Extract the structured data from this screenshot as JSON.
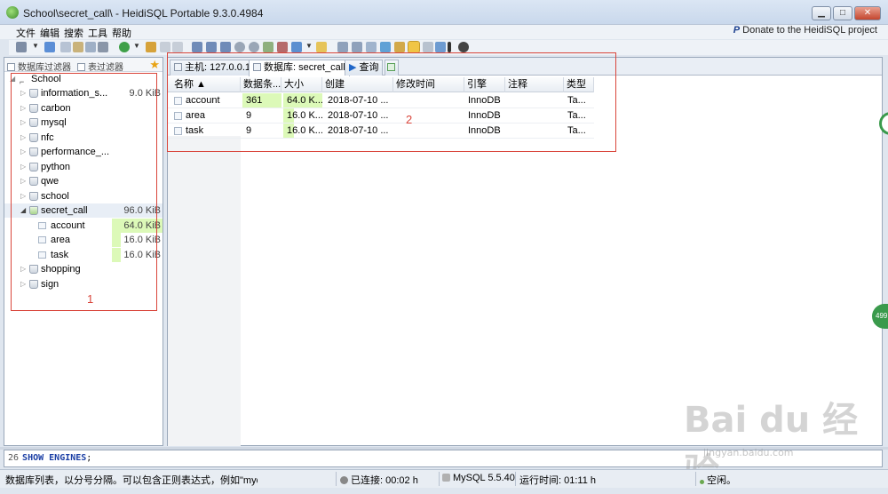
{
  "window": {
    "title": "School\\secret_call\\ - HeidiSQL Portable 9.3.0.4984",
    "minimize": "▁",
    "maximize": "□",
    "close": "✕"
  },
  "menu": {
    "items": [
      "文件",
      "编辑",
      "搜索",
      "工具",
      "帮助"
    ],
    "donate": "Donate to the HeidiSQL project"
  },
  "filters": {
    "db_filter": "数据库过滤器",
    "table_filter": "表过滤器"
  },
  "tree": {
    "root": "School",
    "databases": [
      {
        "name": "information_s...",
        "size": "9.0 KiB"
      },
      {
        "name": "carbon",
        "size": ""
      },
      {
        "name": "mysql",
        "size": ""
      },
      {
        "name": "nfc",
        "size": ""
      },
      {
        "name": "performance_...",
        "size": ""
      },
      {
        "name": "python",
        "size": ""
      },
      {
        "name": "qwe",
        "size": ""
      },
      {
        "name": "school",
        "size": ""
      },
      {
        "name": "secret_call",
        "size": "96.0 KiB"
      },
      {
        "name": "shopping",
        "size": ""
      },
      {
        "name": "sign",
        "size": ""
      }
    ],
    "tables": [
      {
        "name": "account",
        "size": "64.0 KiB"
      },
      {
        "name": "area",
        "size": "16.0 KiB"
      },
      {
        "name": "task",
        "size": "16.0 KiB"
      }
    ]
  },
  "annotations": {
    "left": "1",
    "right": "2"
  },
  "tabs": {
    "host": "主机: 127.0.0.1",
    "database": "数据库: secret_call",
    "query": "查询"
  },
  "grid": {
    "headers": [
      "名称 ▲",
      "数据条...",
      "大小",
      "创建",
      "修改时间",
      "引擎",
      "注释",
      "类型"
    ],
    "rows": [
      {
        "name": "account",
        "rows": "361",
        "size": "64.0 K...",
        "created": "2018-07-10 ...",
        "modified": "",
        "engine": "InnoDB",
        "comment": "",
        "type": "Ta..."
      },
      {
        "name": "area",
        "rows": "9",
        "size": "16.0 K...",
        "created": "2018-07-10 ...",
        "modified": "",
        "engine": "InnoDB",
        "comment": "",
        "type": "Ta..."
      },
      {
        "name": "task",
        "rows": "9",
        "size": "16.0 K...",
        "created": "2018-07-10 ...",
        "modified": "",
        "engine": "InnoDB",
        "comment": "",
        "type": "Ta..."
      }
    ]
  },
  "sqllog": {
    "line": "26",
    "keyword": "SHOW ENGINES",
    "rest": ";"
  },
  "status": {
    "hint": "数据库列表，以分号分隔。可以包含正则表达式，例如\"mydb;te",
    "connected": "已连接: 00:02 h",
    "server": "MySQL 5.5.40",
    "uptime": "运行时间: 01:11 h",
    "idle": "空闲。"
  },
  "overlay": {
    "side_badge": "499",
    "watermark": "Bai du 经验",
    "watermark_url": "jingyan.baidu.com"
  },
  "colors": {
    "highlight_green": "#dcf9b8",
    "annotation_red": "#d9453b"
  }
}
